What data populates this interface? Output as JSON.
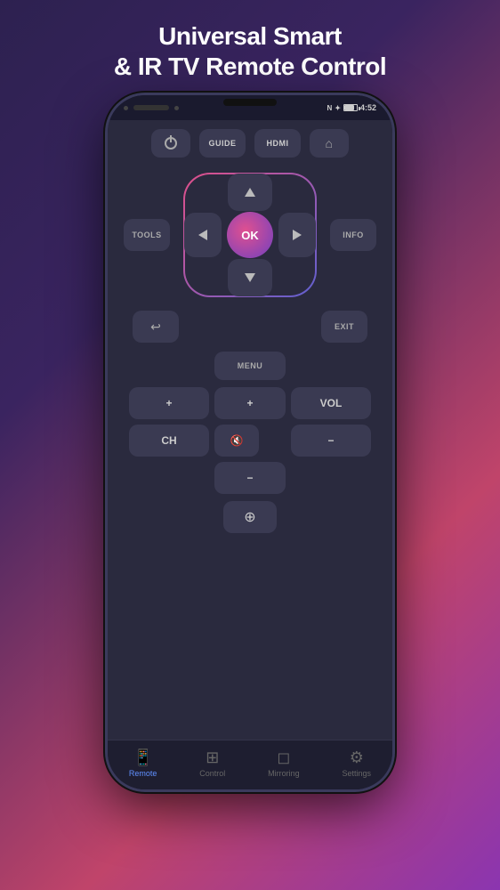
{
  "title": {
    "line1": "Universal Smart",
    "line2": "& IR TV Remote Control"
  },
  "status": {
    "time": "4:52",
    "signal": "wifi",
    "battery": "80"
  },
  "top_buttons": {
    "power": "",
    "guide": "GUIDE",
    "hdmi": "HDMI",
    "home": ""
  },
  "dpad": {
    "ok": "OK",
    "tools": "TOOLS",
    "info": "INFO"
  },
  "control_buttons": {
    "back": "↩",
    "exit": "EXIT",
    "menu": "MENU"
  },
  "volume": {
    "plus": "+",
    "label": "VOL",
    "minus": "−"
  },
  "channel": {
    "plus": "+",
    "label": "CH",
    "minus": "−"
  },
  "mute": "🔇",
  "input_source": "⊕",
  "bottom_nav": {
    "items": [
      {
        "id": "remote",
        "label": "Remote",
        "active": true
      },
      {
        "id": "control",
        "label": "Control",
        "active": false
      },
      {
        "id": "mirroring",
        "label": "Mirroring",
        "active": false
      },
      {
        "id": "settings",
        "label": "Settings",
        "active": false
      }
    ]
  }
}
